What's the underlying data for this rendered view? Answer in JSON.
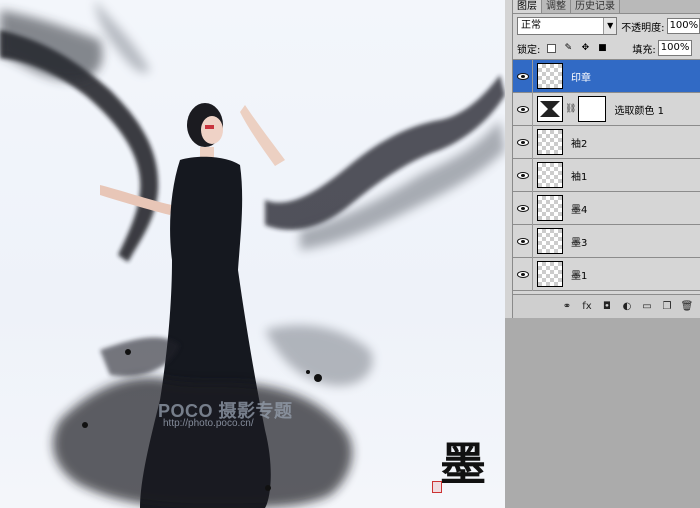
{
  "canvas": {
    "watermark_main": "POCO 摄影专题",
    "watermark_url": "http://photo.poco.cn/",
    "calligraphy": "墨"
  },
  "panel": {
    "tabs": [
      "图层",
      "调整",
      "历史记录"
    ],
    "blend_mode": "正常",
    "opacity_label": "不透明度:",
    "opacity_value": "100%",
    "lock_label": "锁定:",
    "fill_label": "填充:",
    "fill_value": "100%",
    "layers": [
      {
        "name": "印章",
        "selected": true
      },
      {
        "name": "选取颜色 1",
        "selected": false
      },
      {
        "name": "袖2",
        "selected": false
      },
      {
        "name": "袖1",
        "selected": false
      },
      {
        "name": "墨4",
        "selected": false
      },
      {
        "name": "墨3",
        "selected": false
      },
      {
        "name": "墨1",
        "selected": false
      }
    ],
    "bottom_icons": [
      "link-icon",
      "fx-icon",
      "mask-icon",
      "adjustment-icon",
      "folder-icon",
      "new-layer-icon",
      "trash-icon"
    ]
  },
  "colors": {
    "selection": "#316ac5",
    "panel_bg": "#d6d6d6"
  }
}
